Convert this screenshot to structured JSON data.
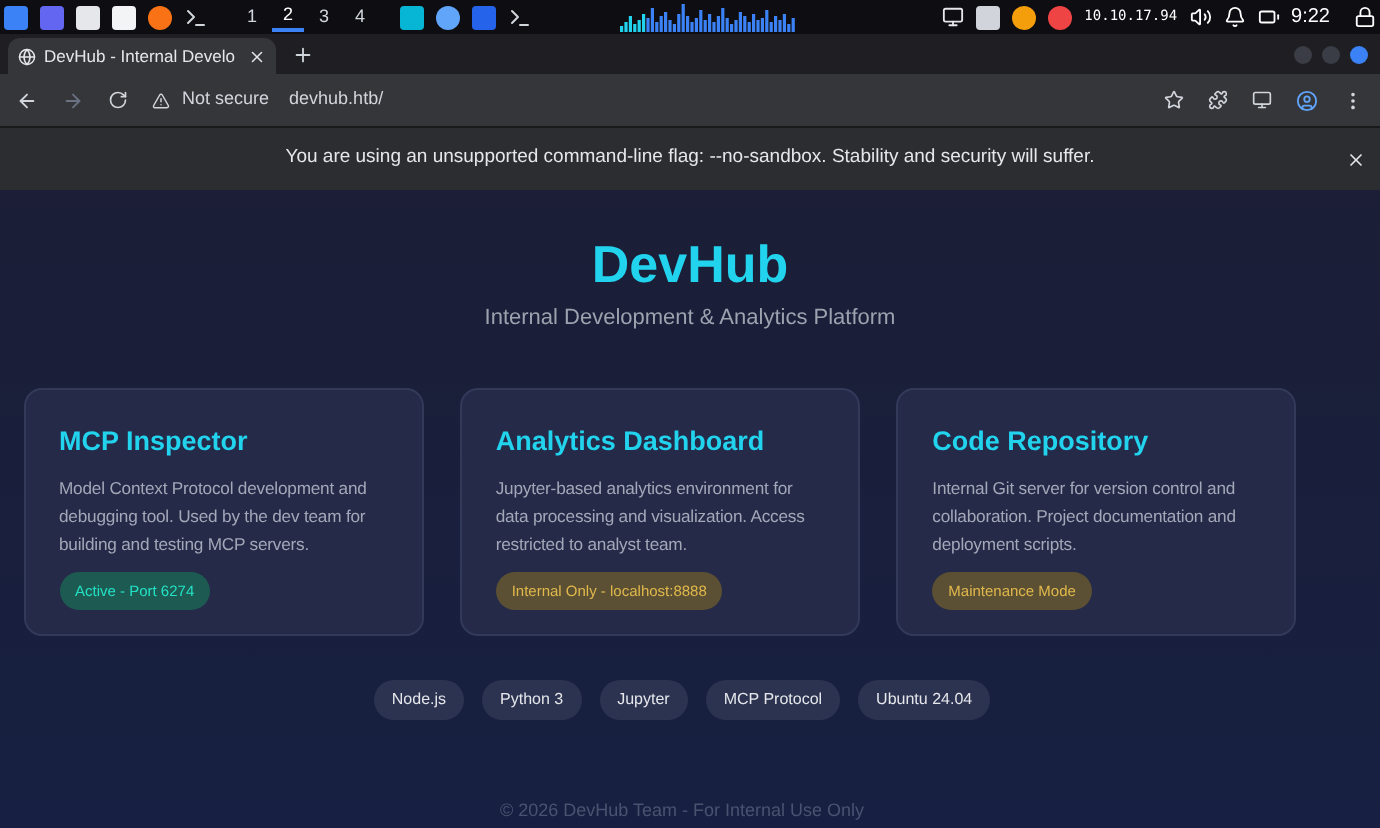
{
  "taskbar": {
    "workspaces": [
      {
        "label": "1",
        "selected": false
      },
      {
        "label": "2",
        "selected": true
      },
      {
        "label": "3",
        "selected": false
      },
      {
        "label": "4",
        "selected": false
      }
    ],
    "ip": "10.10.17.94",
    "time": "9:22"
  },
  "browser": {
    "tab_title": "DevHub - Internal Develo",
    "security": "Not secure",
    "url": "devhub.htb/",
    "infobar": "You are using an unsupported command-line flag: --no-sandbox. Stability and security will suffer."
  },
  "page": {
    "title": "DevHub",
    "subtitle": "Internal Development & Analytics Platform",
    "cards": [
      {
        "title": "MCP Inspector",
        "description": "Model Context Protocol development and debugging tool. Used by the dev team for building and testing MCP servers.",
        "status": "Active - Port 6274",
        "color": "#1d5b52"
      },
      {
        "title": "Analytics Dashboard",
        "description": "Jupyter-based analytics environment for data processing and visualization. Access restricted to analyst team.",
        "status": "Internal Only - localhost:8888",
        "color": "#5b5033"
      },
      {
        "title": "Code Repository",
        "description": "Internal Git server for version control and collaboration. Project documentation and deployment scripts.",
        "status": "Maintenance Mode",
        "color": "#5b5033"
      }
    ],
    "tags": [
      "Node.js",
      "Python 3",
      "Jupyter",
      "MCP Protocol",
      "Ubuntu 24.04"
    ],
    "footer": "© 2026 DevHub Team - For Internal Use Only"
  }
}
